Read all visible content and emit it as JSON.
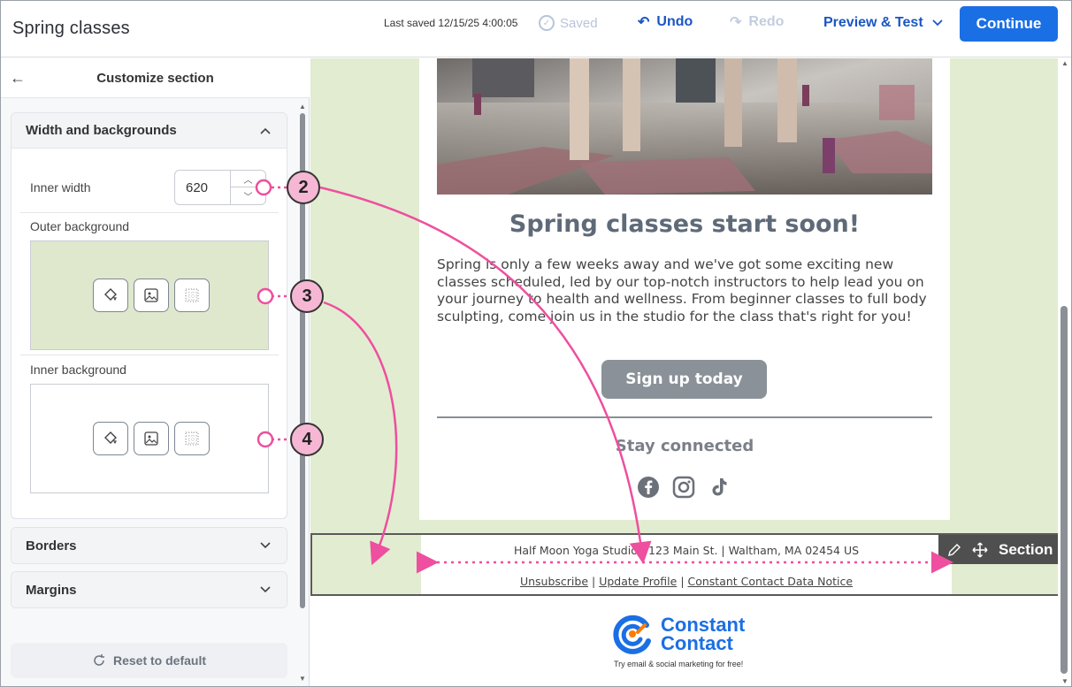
{
  "topbar": {
    "doc_title": "Spring classes",
    "last_saved": "Last saved 12/15/25 4:00:05",
    "saved_label": "Saved",
    "undo_label": "Undo",
    "redo_label": "Redo",
    "preview_label": "Preview & Test",
    "continue_label": "Continue"
  },
  "panel": {
    "title": "Customize section",
    "width_section": {
      "label": "Width and backgrounds",
      "inner_width_label": "Inner width",
      "inner_width_value": "620",
      "outer_background_label": "Outer background",
      "inner_background_label": "Inner background"
    },
    "borders_label": "Borders",
    "margins_label": "Margins",
    "reset_label": "Reset to default"
  },
  "email": {
    "heading": "Spring classes start soon!",
    "body": "Spring is only a few weeks away and we've got some exciting new classes scheduled, led by our top-notch instructors to help lead you on your journey to health and wellness. From beginner classes to full body sculpting, come join us in the studio for the class that's right for you!",
    "button_label": "Sign up today",
    "stay_connected": "Stay connected",
    "address": "Half Moon Yoga Studio | 123 Main St. | Waltham, MA 02454 US",
    "links": {
      "unsubscribe": "Unsubscribe",
      "update_profile": "Update Profile",
      "data_notice": "Constant Contact Data Notice"
    },
    "section_tag": "Section"
  },
  "branding": {
    "logo_line1": "Constant",
    "logo_line2": "Contact",
    "tagline": "Try email & social marketing for free!"
  },
  "callouts": [
    "2",
    "3",
    "4"
  ],
  "colors": {
    "accent": "#1b6fe4",
    "outer_bg": "#e2ecd1",
    "callout": "#f6b7d4",
    "arrow": "#ee4f9e"
  }
}
